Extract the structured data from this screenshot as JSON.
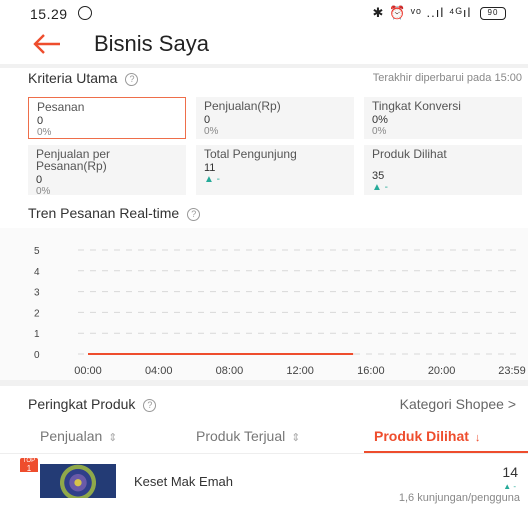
{
  "status_bar": {
    "time": "15.29",
    "right_icons": "✱ ⏰ ᵛᵒ ..ıl ⁴ᴳıl",
    "battery": "90"
  },
  "header": {
    "title": "Bisnis Saya",
    "back_icon": "arrow-left-icon"
  },
  "kriteria": {
    "title": "Kriteria Utama",
    "updated": "Terakhir diperbarui pada 15:00",
    "metrics": [
      {
        "label": "Pesanan",
        "value": "0",
        "sub": "0%"
      },
      {
        "label": "Penjualan(Rp)",
        "value": "0",
        "sub": "0%"
      },
      {
        "label": "Tingkat Konversi",
        "value": "0%",
        "sub": "0%"
      },
      {
        "label": "Penjualan per Pesanan(Rp)",
        "value": "0",
        "sub": "0%"
      },
      {
        "label": "Total Pengunjung",
        "value": "11",
        "sub": "▲ -"
      },
      {
        "label": "Produk Dilihat",
        "value": "35",
        "sub": "▲ -"
      }
    ]
  },
  "tren": {
    "title": "Tren Pesanan Real-time"
  },
  "chart_data": {
    "type": "line",
    "title": "Tren Pesanan Real-time",
    "x": [
      "00:00",
      "04:00",
      "08:00",
      "12:00",
      "16:00",
      "20:00",
      "23:59"
    ],
    "y_ticks": [
      "0",
      "1",
      "2",
      "3",
      "4",
      "5"
    ],
    "ylim": [
      0,
      5
    ],
    "series": [
      {
        "values": [
          0,
          0,
          0,
          0,
          0
        ],
        "x": [
          "00:00",
          "04:00",
          "08:00",
          "12:00",
          "15:00"
        ],
        "color": "#ee4d2d"
      }
    ],
    "grid": true
  },
  "peringkat": {
    "title": "Peringkat Produk",
    "kategori": "Kategori Shopee >",
    "tabs": [
      {
        "label": "Penjualan",
        "sort": "⇕"
      },
      {
        "label": "Produk Terjual",
        "sort": "⇕"
      },
      {
        "label": "Produk Dilihat",
        "sort": "↓"
      }
    ]
  },
  "product": {
    "badge": "TOP",
    "rank": "1",
    "name": "Keset Mak Emah",
    "count": "14",
    "trend": "▲ -",
    "sub": "1,6 kunjungan/pengguna"
  }
}
